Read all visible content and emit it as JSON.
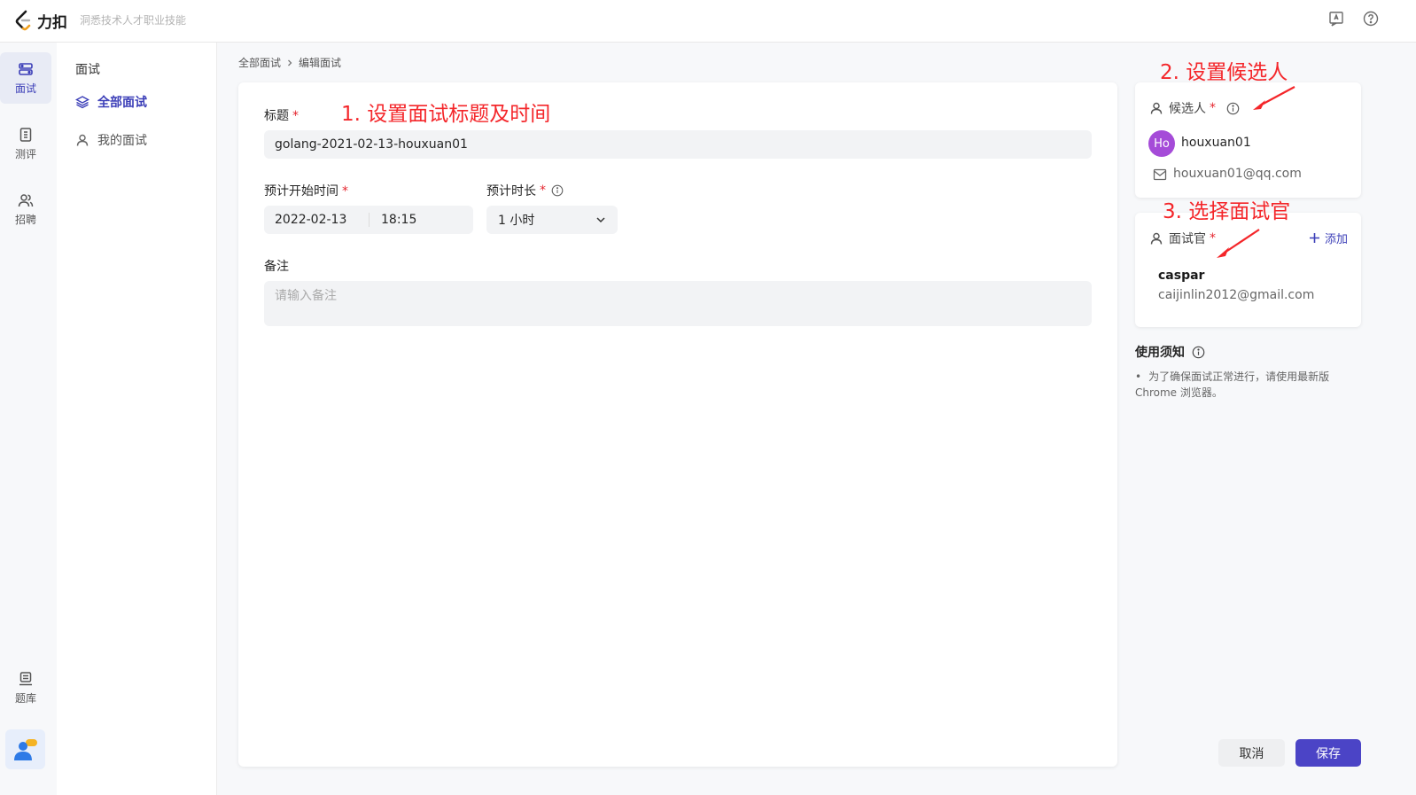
{
  "app": {
    "brand": "力扣",
    "slogan": "洞悉技术人才职业技能"
  },
  "left_nav": [
    {
      "label": "面试",
      "icon": "interview-icon"
    },
    {
      "label": "测评",
      "icon": "assessment-icon"
    },
    {
      "label": "招聘",
      "icon": "recruit-icon"
    },
    {
      "label": "题库",
      "icon": "question-bank-icon"
    }
  ],
  "sub_nav": {
    "title": "面试",
    "items": [
      {
        "label": "全部面试",
        "icon": "layers-icon",
        "active": true
      },
      {
        "label": "我的面试",
        "icon": "user-icon",
        "active": false
      }
    ]
  },
  "breadcrumb": {
    "root": "全部面试",
    "current": "编辑面试"
  },
  "form": {
    "title_label": "标题",
    "title_value": "golang-2021-02-13-houxuan01",
    "start_label": "预计开始时间",
    "start_date": "2022-02-13",
    "start_time": "18:15",
    "duration_label": "预计时长",
    "duration_value": "1 小时",
    "note_label": "备注",
    "note_placeholder": "请输入备注",
    "required_mark": "*"
  },
  "candidate": {
    "header": "候选人",
    "avatar_text": "Ho",
    "name": "houxuan01",
    "email": "houxuan01@qq.com",
    "avatar_color": "#a54bd8"
  },
  "interviewer": {
    "header": "面试官",
    "add_label": "添加",
    "name": "caspar",
    "email": "caijinlin2012@gmail.com"
  },
  "notice": {
    "title": "使用须知",
    "bullet": "•",
    "text": "为了确保面试正常进行，请使用最新版 Chrome 浏览器。"
  },
  "annotations": {
    "step1": "1. 设置面试标题及时间",
    "step2": "2. 设置候选人",
    "step3": "3. 选择面试官"
  },
  "actions": {
    "cancel": "取消",
    "save": "保存"
  },
  "colors": {
    "accent": "#4b44c6",
    "annotation": "#f4262a",
    "required": "#e5262f"
  }
}
